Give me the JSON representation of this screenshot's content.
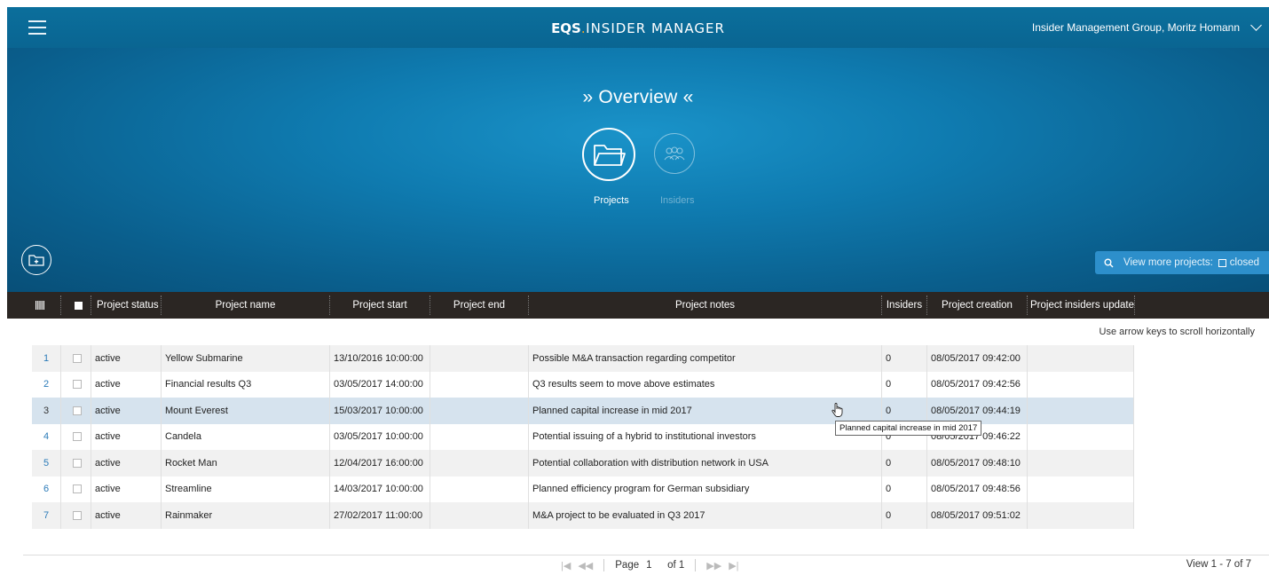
{
  "header": {
    "brand_eqs": "EQS",
    "brand_dot": ".",
    "brand_rest": "INSIDER MANAGER",
    "user": "Insider Management Group, Moritz Homann"
  },
  "hero": {
    "title": "» Overview «",
    "modes": {
      "projects": "Projects",
      "insiders": "Insiders"
    },
    "view_more": "View more projects:",
    "closed": "closed"
  },
  "table": {
    "columns": {
      "status": "Project status",
      "name": "Project name",
      "start": "Project start",
      "end": "Project end",
      "notes": "Project notes",
      "insiders": "Insiders",
      "creation": "Project creation",
      "update": "Project insiders update"
    },
    "hint": "Use arrow keys to scroll horizontally",
    "rows": [
      {
        "num": "1",
        "status": "active",
        "name": "Yellow Submarine",
        "start": "13/10/2016 10:00:00",
        "end": "",
        "notes": "Possible M&A transaction regarding competitor",
        "insiders": "0",
        "creation": "08/05/2017 09:42:00",
        "update": ""
      },
      {
        "num": "2",
        "status": "active",
        "name": "Financial results Q3",
        "start": "03/05/2017 14:00:00",
        "end": "",
        "notes": "Q3 results seem to move above estimates",
        "insiders": "0",
        "creation": "08/05/2017 09:42:56",
        "update": ""
      },
      {
        "num": "3",
        "status": "active",
        "name": "Mount Everest",
        "start": "15/03/2017 10:00:00",
        "end": "",
        "notes": "Planned capital increase in mid 2017",
        "insiders": "0",
        "creation": "08/05/2017 09:44:19",
        "update": ""
      },
      {
        "num": "4",
        "status": "active",
        "name": "Candela",
        "start": "03/05/2017 10:00:00",
        "end": "",
        "notes": "Potential issuing of a hybrid to institutional investors",
        "insiders": "0",
        "creation": "08/05/2017 09:46:22",
        "update": ""
      },
      {
        "num": "5",
        "status": "active",
        "name": "Rocket Man",
        "start": "12/04/2017 16:00:00",
        "end": "",
        "notes": "Potential collaboration with distribution network in USA",
        "insiders": "0",
        "creation": "08/05/2017 09:48:10",
        "update": ""
      },
      {
        "num": "6",
        "status": "active",
        "name": "Streamline",
        "start": "14/03/2017 10:00:00",
        "end": "",
        "notes": "Planned efficiency program for German subsidiary",
        "insiders": "0",
        "creation": "08/05/2017 09:48:56",
        "update": ""
      },
      {
        "num": "7",
        "status": "active",
        "name": "Rainmaker",
        "start": "27/02/2017 11:00:00",
        "end": "",
        "notes": "M&A project to be evaluated in Q3 2017",
        "insiders": "0",
        "creation": "08/05/2017 09:51:02",
        "update": ""
      }
    ],
    "tooltip": "Planned capital increase in mid 2017"
  },
  "pager": {
    "page_label": "Page",
    "page": "1",
    "of_label": "of 1",
    "view_count": "View 1 - 7 of 7"
  },
  "colors": {
    "header_bg": "#0a6592",
    "table_header_bg": "#2b2623",
    "row_hover": "#d6e3ee",
    "accent_link": "#2a7ab8",
    "brand_dot": "#f5a623"
  },
  "icons": [
    "menu-icon",
    "chevron-down-icon",
    "folder-icon",
    "people-icon",
    "add-folder-icon",
    "search-icon",
    "columns-icon",
    "checkbox-icon",
    "hand-cursor-icon",
    "first-page-icon",
    "prev-page-icon",
    "next-page-icon",
    "last-page-icon"
  ]
}
